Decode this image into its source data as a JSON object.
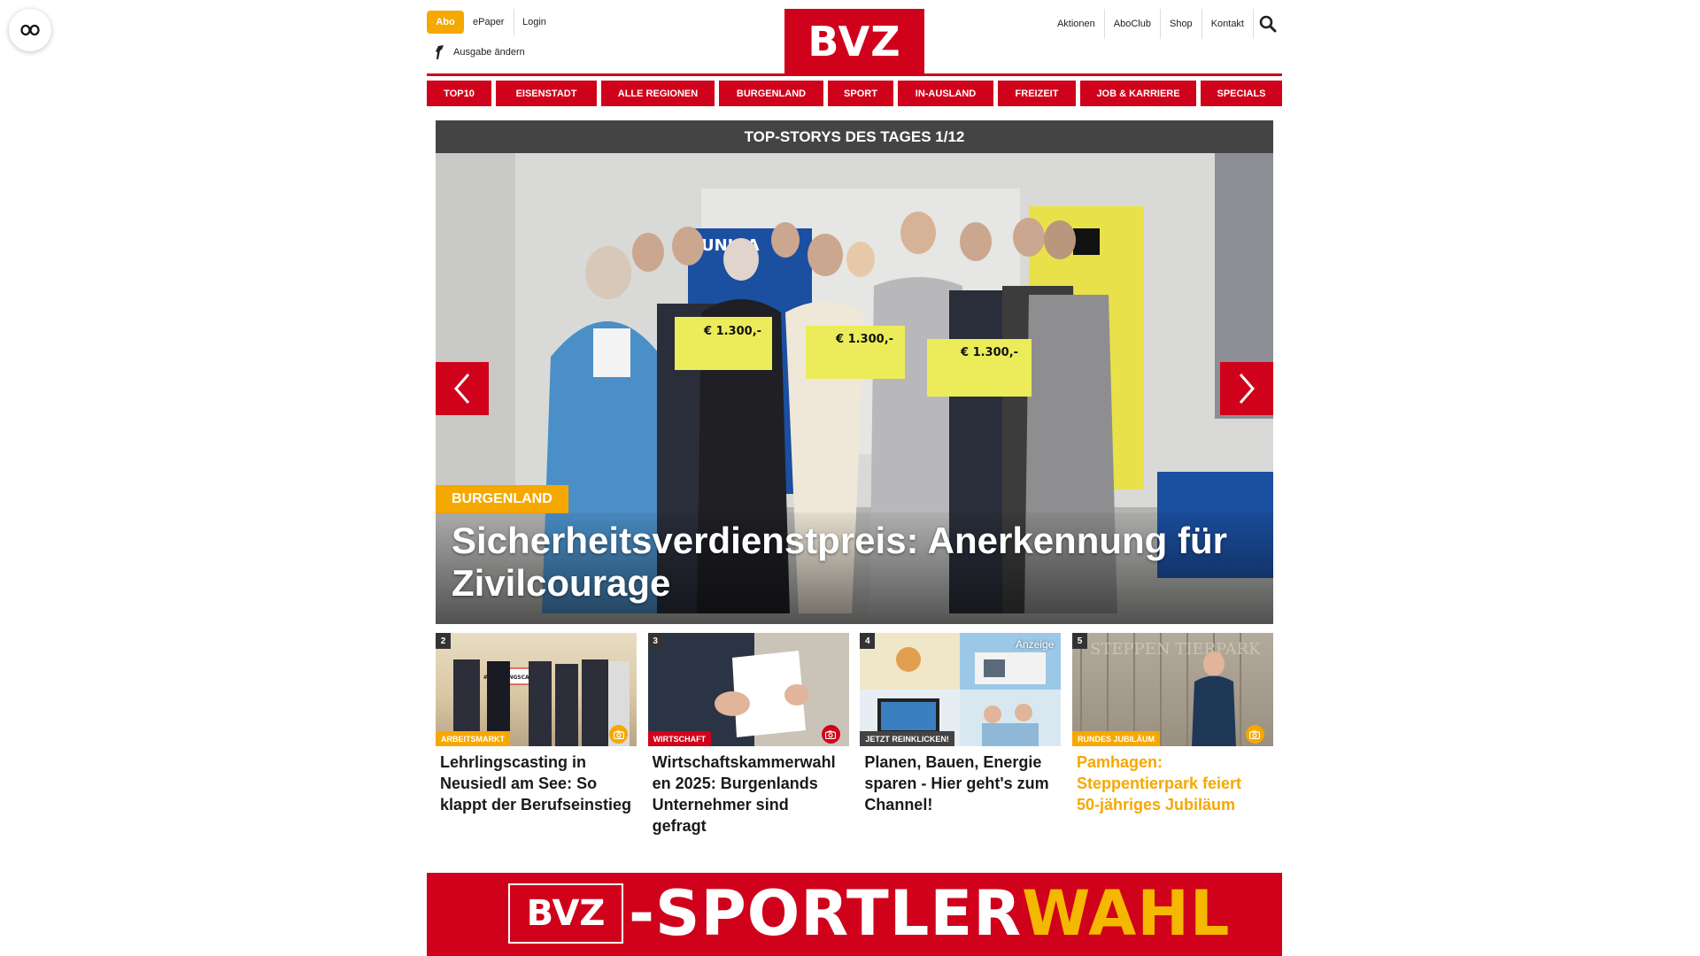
{
  "header": {
    "abo_label": "Abo",
    "epaper_label": "ePaper",
    "login_label": "Login",
    "ausgabe_label": "Ausgabe ändern",
    "logo_text": "BVZ",
    "right_links": [
      "Aktionen",
      "AboClub",
      "Shop",
      "Kontakt"
    ]
  },
  "nav": {
    "items": [
      "TOP10",
      "EISENSTADT",
      "ALLE REGIONEN",
      "BURGENLAND",
      "SPORT",
      "IN-AUSLAND",
      "FREIZEIT",
      "JOB & KARRIERE",
      "SPECIALS"
    ]
  },
  "hero": {
    "bar_title": "TOP-STORYS DES TAGES 1/12",
    "category": "BURGENLAND",
    "title": "Sicherheitsverdienstpreis: Anerkennung für Zivilcourage",
    "banner_text": "UNIQA",
    "check_amount": "€ 1.300,-"
  },
  "cards": [
    {
      "num": "2",
      "tag": "ARBEITSMARKT",
      "title": "Lehrlingscasting in Neusiedl am See: So klappt der Berufseinstieg",
      "image_sign": "#LEHRLINGSCASTING"
    },
    {
      "num": "3",
      "tag": "WIRTSCHAFT",
      "title": "Wirtschaftskammerwahl en 2025: Burgenlands Unternehmer sind gefragt"
    },
    {
      "num": "4",
      "tag": "JETZT REINKLICKEN!",
      "title": "Planen, Bauen, Energie sparen - Hier geht's zum Channel!",
      "badge": "Anzeige"
    },
    {
      "num": "5",
      "tag": "RUNDES JUBILÄUM",
      "title": "Pamhagen: Steppentierpark feiert 50-jähriges Jubiläum",
      "sign_text": "STEPPEN TIERPARK"
    }
  ],
  "banner": {
    "logo_text": "BVZ",
    "text_white": "-SPORTLER",
    "text_yellow": "WAHL"
  },
  "colors": {
    "brand_red": "#d0021b",
    "accent_yellow": "#f5a800",
    "dark_bar": "#444444"
  }
}
